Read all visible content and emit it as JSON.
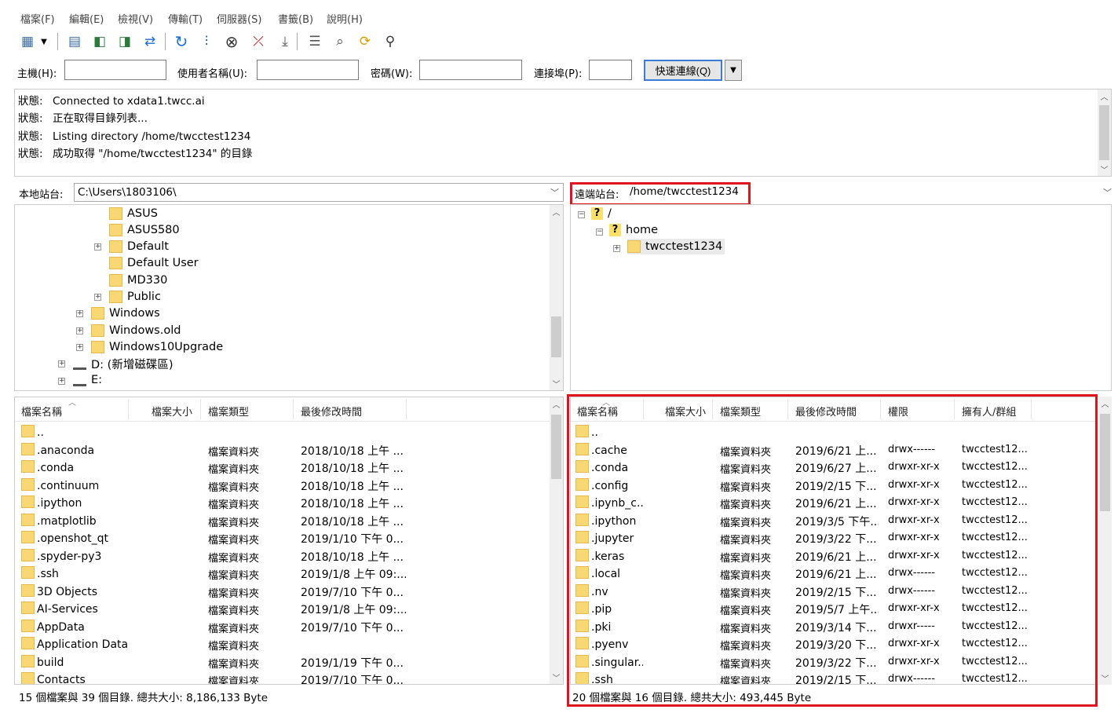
{
  "menu": [
    "檔案(F)",
    "編輯(E)",
    "檢視(V)",
    "傳輸(T)",
    "伺服器(S)",
    "書籤(B)",
    "說明(H)"
  ],
  "toolbar_icons": [
    "site-manager-icon",
    "dropdown-icon",
    "message-log-icon",
    "local-tree-icon",
    "remote-tree-icon",
    "transfer-queue-icon",
    "refresh-icon",
    "process-queue-icon",
    "cancel-icon",
    "disconnect-icon",
    "reconnect-icon",
    "directory-compare-icon",
    "search-icon",
    "sync-browse-icon",
    "find-files-icon"
  ],
  "quickconnect": {
    "host_label": "主機(H):",
    "user_label": "使用者名稱(U):",
    "pass_label": "密碼(W):",
    "port_label": "連接埠(P):",
    "connect_label": "快速連線(Q)",
    "host": "",
    "user": "",
    "pass": "",
    "port": ""
  },
  "log": [
    {
      "k": "狀態:",
      "v": "Connected to xdata1.twcc.ai"
    },
    {
      "k": "狀態:",
      "v": "正在取得目錄列表..."
    },
    {
      "k": "狀態:",
      "v": "Listing directory /home/twcctest1234"
    },
    {
      "k": "狀態:",
      "v": "成功取得 \"/home/twcctest1234\" 的目錄"
    }
  ],
  "local": {
    "label": "本地站台:",
    "path": "C:\\Users\\1803106\\",
    "tree": [
      "ASUS",
      "ASUS580",
      "Default",
      "Default User",
      "MD330",
      "Public",
      "Windows",
      "Windows.old",
      "Windows10Upgrade",
      "D: (新增磁碟區)",
      "E:"
    ],
    "columns": [
      "檔案名稱",
      "檔案大小",
      "檔案類型",
      "最後修改時間"
    ],
    "files": [
      {
        "name": "..",
        "size": "",
        "type": "",
        "modified": ""
      },
      {
        "name": ".anaconda",
        "size": "",
        "type": "檔案資料夾",
        "modified": "2018/10/18 上午 ..."
      },
      {
        "name": ".conda",
        "size": "",
        "type": "檔案資料夾",
        "modified": "2018/10/18 上午 ..."
      },
      {
        "name": ".continuum",
        "size": "",
        "type": "檔案資料夾",
        "modified": "2018/10/18 上午 ..."
      },
      {
        "name": ".ipython",
        "size": "",
        "type": "檔案資料夾",
        "modified": "2018/10/18 上午 ..."
      },
      {
        "name": ".matplotlib",
        "size": "",
        "type": "檔案資料夾",
        "modified": "2018/10/18 上午 ..."
      },
      {
        "name": ".openshot_qt",
        "size": "",
        "type": "檔案資料夾",
        "modified": "2019/1/10 下午 0..."
      },
      {
        "name": ".spyder-py3",
        "size": "",
        "type": "檔案資料夾",
        "modified": "2018/10/18 上午 ..."
      },
      {
        "name": ".ssh",
        "size": "",
        "type": "檔案資料夾",
        "modified": "2019/1/8 上午 09:..."
      },
      {
        "name": "3D Objects",
        "size": "",
        "type": "檔案資料夾",
        "modified": "2019/7/10 下午 0..."
      },
      {
        "name": "AI-Services",
        "size": "",
        "type": "檔案資料夾",
        "modified": "2019/1/8 上午 09:..."
      },
      {
        "name": "AppData",
        "size": "",
        "type": "檔案資料夾",
        "modified": "2019/7/10 下午 0..."
      },
      {
        "name": "Application Data",
        "size": "",
        "type": "檔案資料夾",
        "modified": ""
      },
      {
        "name": "build",
        "size": "",
        "type": "檔案資料夾",
        "modified": "2019/1/19 下午 0..."
      },
      {
        "name": "Contacts",
        "size": "",
        "type": "檔案資料夾",
        "modified": "2019/7/10 下午 0..."
      }
    ],
    "status": "15 個檔案與 39 個目錄. 總共大小: 8,186,133 Byte"
  },
  "remote": {
    "label": "遠端站台:",
    "path": "/home/twcctest1234",
    "tree": [
      "/",
      "home",
      "twcctest1234"
    ],
    "columns": [
      "檔案名稱",
      "檔案大小",
      "檔案類型",
      "最後修改時間",
      "權限",
      "擁有人/群組"
    ],
    "files": [
      {
        "name": "..",
        "size": "",
        "type": "",
        "modified": "",
        "perm": "",
        "owner": ""
      },
      {
        "name": ".cache",
        "size": "",
        "type": "檔案資料夾",
        "modified": "2019/6/21 上...",
        "perm": "drwx------",
        "owner": "twcctest12..."
      },
      {
        "name": ".conda",
        "size": "",
        "type": "檔案資料夾",
        "modified": "2019/6/27 上...",
        "perm": "drwxr-xr-x",
        "owner": "twcctest12..."
      },
      {
        "name": ".config",
        "size": "",
        "type": "檔案資料夾",
        "modified": "2019/2/15 下...",
        "perm": "drwxr-xr-x",
        "owner": "twcctest12..."
      },
      {
        "name": ".ipynb_c...",
        "size": "",
        "type": "檔案資料夾",
        "modified": "2019/6/21 上...",
        "perm": "drwxr-xr-x",
        "owner": "twcctest12..."
      },
      {
        "name": ".ipython",
        "size": "",
        "type": "檔案資料夾",
        "modified": "2019/3/5 下午...",
        "perm": "drwxr-xr-x",
        "owner": "twcctest12..."
      },
      {
        "name": ".jupyter",
        "size": "",
        "type": "檔案資料夾",
        "modified": "2019/3/22 下...",
        "perm": "drwxr-xr-x",
        "owner": "twcctest12..."
      },
      {
        "name": ".keras",
        "size": "",
        "type": "檔案資料夾",
        "modified": "2019/6/21 上...",
        "perm": "drwxr-xr-x",
        "owner": "twcctest12..."
      },
      {
        "name": ".local",
        "size": "",
        "type": "檔案資料夾",
        "modified": "2019/6/21 上...",
        "perm": "drwx------",
        "owner": "twcctest12..."
      },
      {
        "name": ".nv",
        "size": "",
        "type": "檔案資料夾",
        "modified": "2019/2/15 下...",
        "perm": "drwx------",
        "owner": "twcctest12..."
      },
      {
        "name": ".pip",
        "size": "",
        "type": "檔案資料夾",
        "modified": "2019/5/7 上午...",
        "perm": "drwxr-xr-x",
        "owner": "twcctest12..."
      },
      {
        "name": ".pki",
        "size": "",
        "type": "檔案資料夾",
        "modified": "2019/3/14 下...",
        "perm": "drwxr-----",
        "owner": "twcctest12..."
      },
      {
        "name": ".pyenv",
        "size": "",
        "type": "檔案資料夾",
        "modified": "2019/3/20 下...",
        "perm": "drwxr-xr-x",
        "owner": "twcctest12..."
      },
      {
        "name": ".singular...",
        "size": "",
        "type": "檔案資料夾",
        "modified": "2019/3/22 下...",
        "perm": "drwxr-xr-x",
        "owner": "twcctest12..."
      },
      {
        "name": ".ssh",
        "size": "",
        "type": "檔案資料夾",
        "modified": "2019/2/15 下...",
        "perm": "drwx------",
        "owner": "twcctest12..."
      }
    ],
    "status": "20 個檔案與 16 個目錄. 總共大小: 493,445 Byte"
  },
  "colors": {
    "highlight": "#e0141e",
    "folder": "#f8d775",
    "accent": "#3a7bd5"
  }
}
